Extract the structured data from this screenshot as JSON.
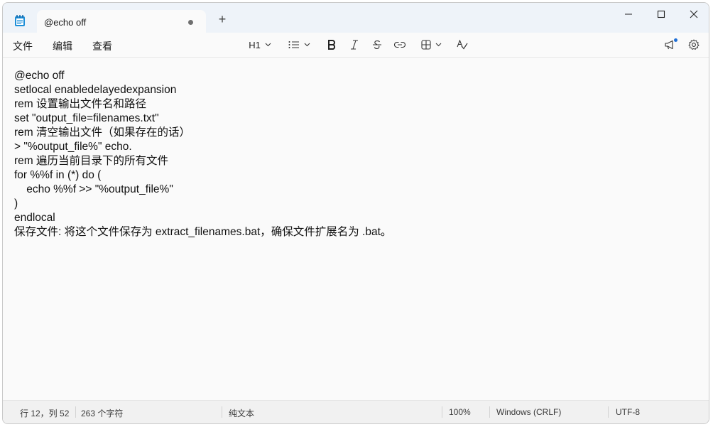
{
  "tab": {
    "title": "@echo off",
    "new_tab_label": "+"
  },
  "menu": {
    "file": "文件",
    "edit": "编辑",
    "view": "查看"
  },
  "toolbar": {
    "heading": "H1"
  },
  "editor": {
    "lines": [
      "@echo off",
      "setlocal enabledelayedexpansion",
      "rem 设置输出文件名和路径",
      "set \"output_file=filenames.txt\"",
      "rem 清空输出文件（如果存在的话）",
      "> \"%output_file%\" echo.",
      "rem 遍历当前目录下的所有文件",
      "for %%f in (*) do (",
      "    echo %%f >> \"%output_file%\"",
      ")",
      "endlocal",
      "保存文件: 将这个文件保存为 extract_filenames.bat，确保文件扩展名为 .bat。"
    ]
  },
  "status": {
    "position": "行 12，列 52",
    "char_count": "263 个字符",
    "format": "纯文本",
    "zoom": "100%",
    "line_ending": "Windows (CRLF)",
    "encoding": "UTF-8"
  },
  "colors": {
    "titlebar": "#eef3f9",
    "accent": "#1f6fd6"
  }
}
